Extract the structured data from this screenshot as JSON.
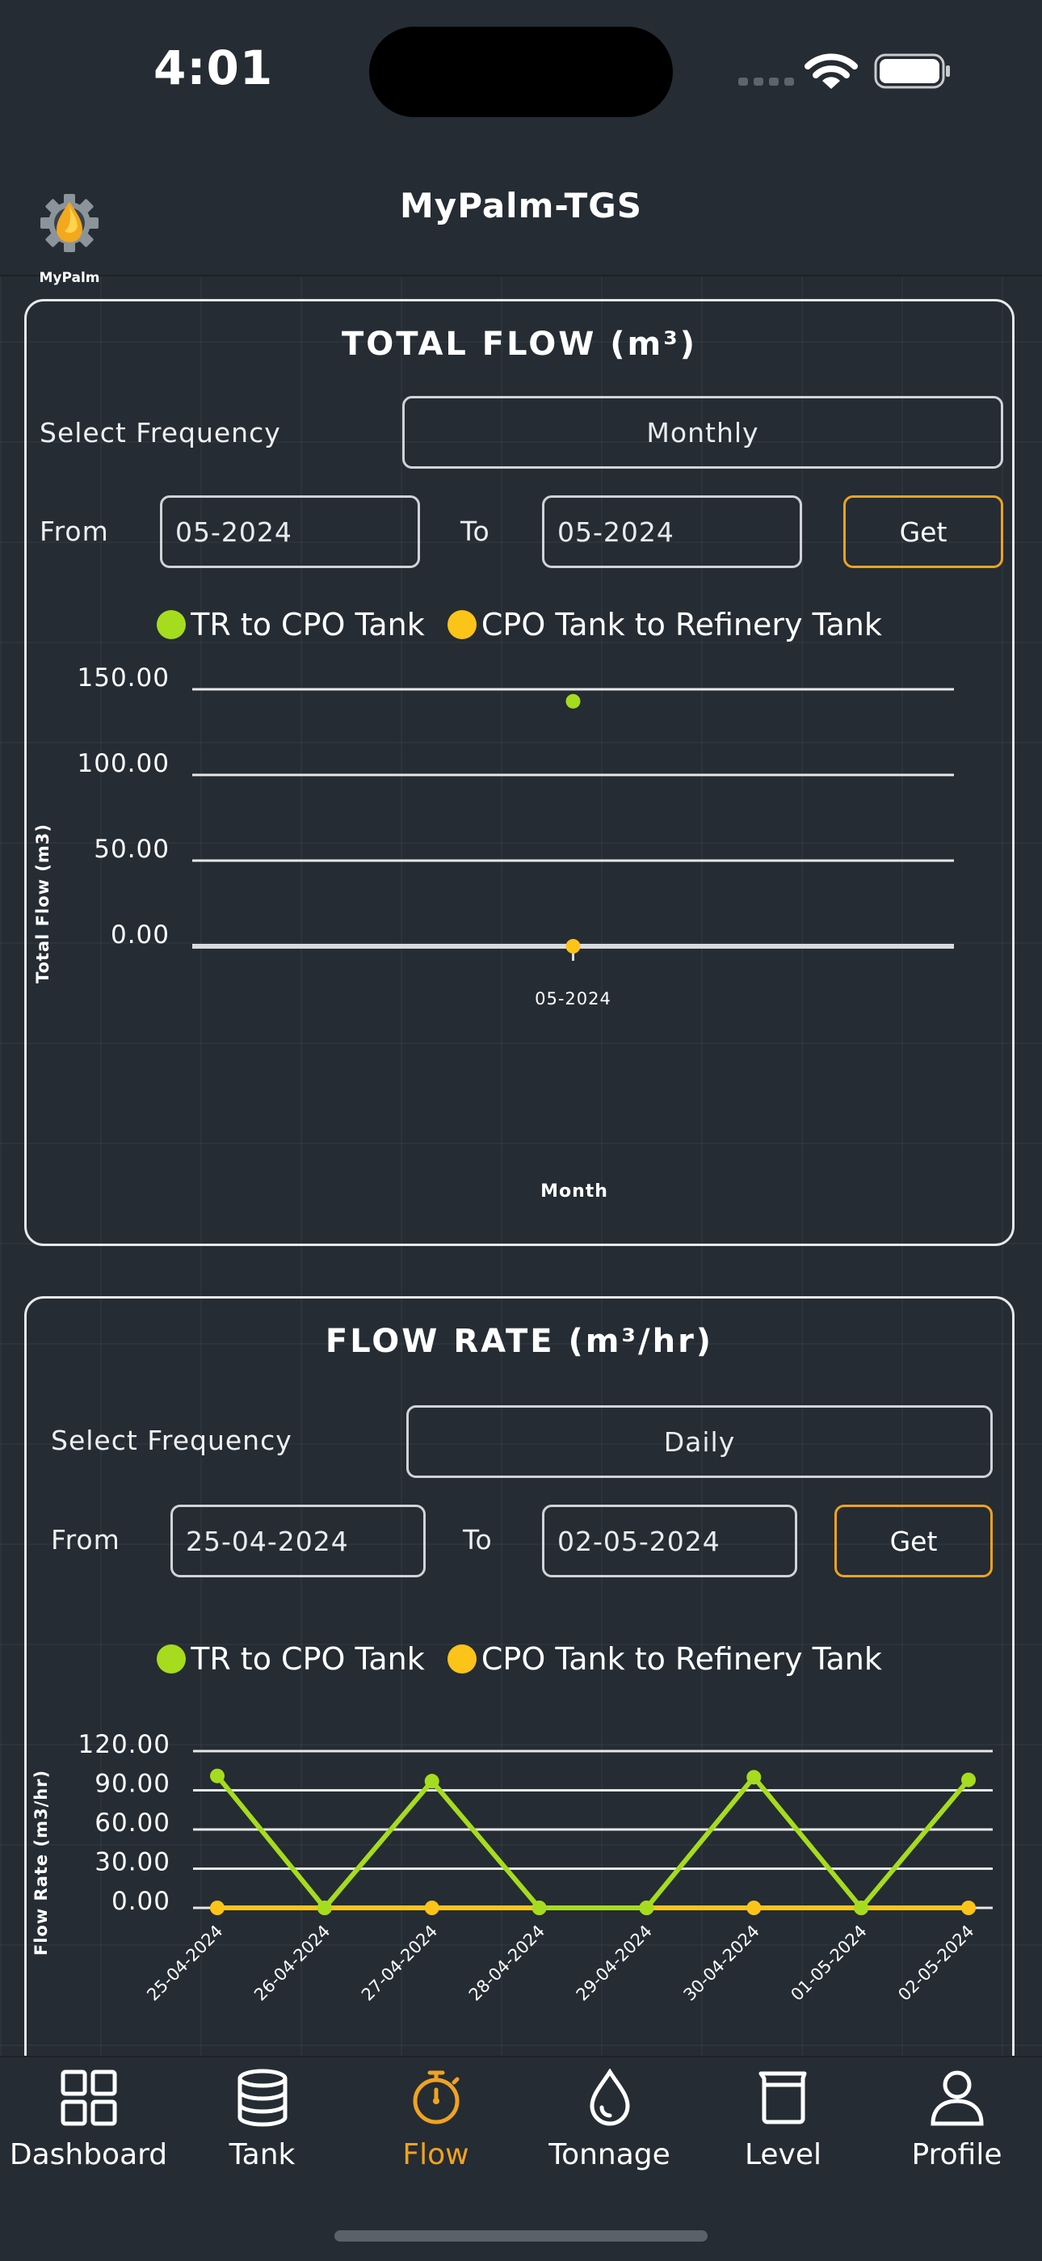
{
  "status_bar": {
    "time": "4:01"
  },
  "header": {
    "logo_text": "MyPalm",
    "title": "MyPalm-TGS"
  },
  "total_flow": {
    "title": "TOTAL FLOW (m³)",
    "frequency_label": "Select Frequency",
    "frequency_value": "Monthly",
    "from_label": "From",
    "from_value": "05-2024",
    "to_label": "To",
    "to_value": "05-2024",
    "get_label": "Get",
    "legend": [
      {
        "name": "TR to CPO Tank",
        "color": "#a6dc1e"
      },
      {
        "name": "CPO Tank to Refinery Tank",
        "color": "#fcc419"
      }
    ]
  },
  "flow_rate": {
    "title": "FLOW RATE (m³/hr)",
    "frequency_label": "Select Frequency",
    "frequency_value": "Daily",
    "from_label": "From",
    "from_value": "25-04-2024",
    "to_label": "To",
    "to_value": "02-05-2024",
    "get_label": "Get",
    "legend": [
      {
        "name": "TR to CPO Tank",
        "color": "#a6dc1e"
      },
      {
        "name": "CPO Tank to Refinery Tank",
        "color": "#fcc419"
      }
    ]
  },
  "chart_data": [
    {
      "type": "scatter",
      "ylabel": "Total Flow (m3)",
      "xlabel": "Month",
      "categories": [
        "05-2024"
      ],
      "yticks": [
        "150.00",
        "100.00",
        "50.00",
        "0.00"
      ],
      "ylim": [
        0,
        150
      ],
      "series": [
        {
          "name": "TR to CPO Tank",
          "color": "#a6dc1e",
          "values": [
            143
          ]
        },
        {
          "name": "CPO Tank to Refinery Tank",
          "color": "#fcc419",
          "values": [
            0
          ]
        }
      ]
    },
    {
      "type": "line",
      "ylabel": "Flow Rate (m3/hr)",
      "categories": [
        "25-04-2024",
        "26-04-2024",
        "27-04-2024",
        "28-04-2024",
        "29-04-2024",
        "30-04-2024",
        "01-05-2024",
        "02-05-2024"
      ],
      "yticks": [
        "120.00",
        "90.00",
        "60.00",
        "30.00",
        "0.00"
      ],
      "ylim": [
        0,
        120
      ],
      "series": [
        {
          "name": "TR to CPO Tank",
          "color": "#a6dc1e",
          "values": [
            101,
            0,
            97,
            0,
            0,
            100,
            0,
            98
          ]
        },
        {
          "name": "CPO Tank to Refinery Tank",
          "color": "#fcc419",
          "values": [
            0,
            0,
            0,
            0,
            0,
            0,
            0,
            0
          ]
        }
      ]
    }
  ],
  "nav": {
    "items": [
      {
        "label": "Dashboard",
        "icon": "grid-icon"
      },
      {
        "label": "Tank",
        "icon": "database-icon"
      },
      {
        "label": "Flow",
        "icon": "stopwatch-icon"
      },
      {
        "label": "Tonnage",
        "icon": "droplet-icon"
      },
      {
        "label": "Level",
        "icon": "beaker-icon"
      },
      {
        "label": "Profile",
        "icon": "user-icon"
      }
    ],
    "active": "Flow",
    "active_color": "#f0a320"
  }
}
